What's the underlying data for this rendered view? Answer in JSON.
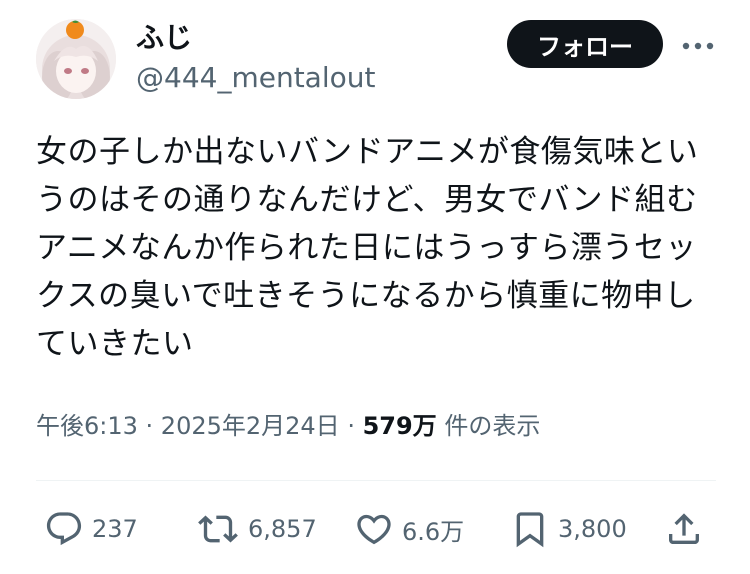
{
  "user": {
    "display_name": "ふじ",
    "handle": "@444_mentalout"
  },
  "header": {
    "follow_label": "フォロー",
    "more_label": "···"
  },
  "tweet": {
    "lines": [
      "女の子しか出ないバンドアニメが食傷気味とい",
      "うのはその通りなんだけど、男女でバンド組む",
      "アニメなんか作られた日にはうっすら漂うセッ",
      "クスの臭いで吐きそうになるから慎重に物申し",
      "ていきたい"
    ]
  },
  "meta": {
    "time": "午後6:13",
    "separator": " · ",
    "date": "2025年2月24日",
    "views_count": "579万",
    "views_label": " 件の表示"
  },
  "actions": {
    "reply_count": "237",
    "retweet_count": "6,857",
    "like_count": "6.6万",
    "bookmark_count": "3,800"
  },
  "icons": {
    "reply": "reply-icon",
    "retweet": "retweet-icon",
    "like": "heart-icon",
    "bookmark": "bookmark-icon",
    "share": "share-icon",
    "more": "more-icon"
  },
  "colors": {
    "text_primary": "#0f1419",
    "text_secondary": "#536471",
    "follow_bg": "#0f1419",
    "divider": "#eff3f4"
  }
}
